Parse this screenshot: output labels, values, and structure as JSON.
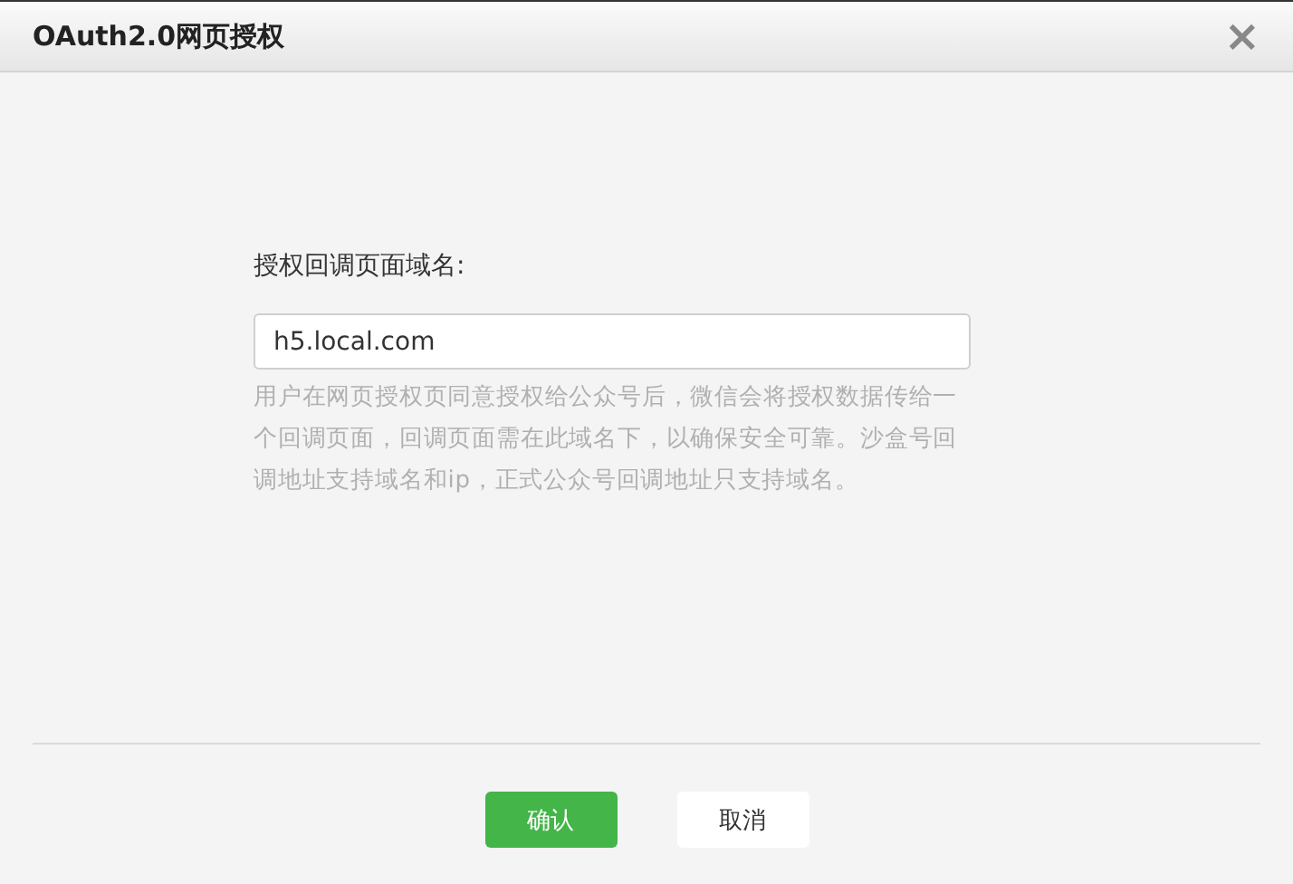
{
  "dialog": {
    "title": "OAuth2.0网页授权",
    "close": "×"
  },
  "form": {
    "label": "授权回调页面域名:",
    "value": "h5.local.com",
    "hint": "用户在网页授权页同意授权给公众号后，微信会将授权数据传给一个回调页面，回调页面需在此域名下，以确保安全可靠。沙盒号回调地址支持域名和ip，正式公众号回调地址只支持域名。"
  },
  "buttons": [
    {
      "label": "确认",
      "kind": "primary"
    },
    {
      "label": "取消",
      "kind": "default"
    }
  ]
}
